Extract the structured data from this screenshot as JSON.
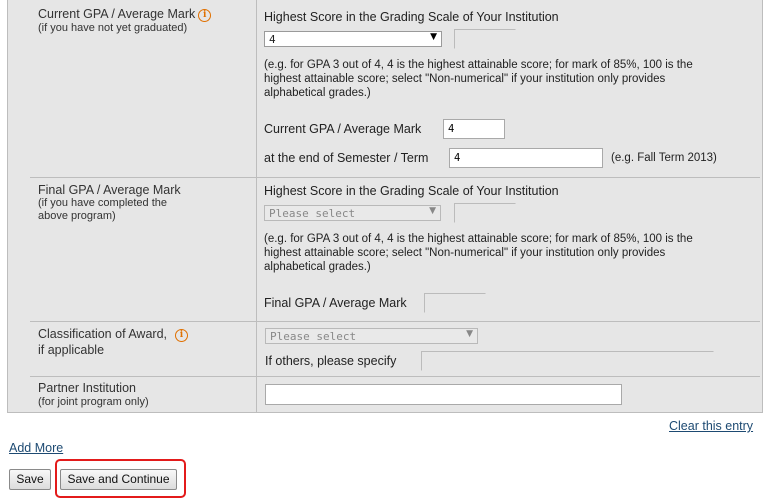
{
  "current_gpa": {
    "label": "Current GPA / Average Mark",
    "sublabel": "(if you have not yet graduated)",
    "heading": "Highest Score in the Grading Scale of Your Institution",
    "scale_select": "4",
    "note": "(e.g. for GPA 3 out of 4, 4 is the highest attainable score; for mark of 85%, 100 is the highest attainable score; select \"Non-numerical\" if your institution only provides alphabetical grades.)",
    "mark_label": "Current GPA / Average Mark",
    "mark_value": "4",
    "term_label": "at the end of Semester / Term",
    "term_value": "4",
    "term_hint": "(e.g. Fall Term 2013)"
  },
  "final_gpa": {
    "label": "Final GPA / Average Mark",
    "sublabel_line1": "(if you have completed the",
    "sublabel_line2": "above program)",
    "heading": "Highest Score in the Grading Scale of Your Institution",
    "scale_select": "Please select",
    "note": "(e.g. for GPA 3 out of 4, 4 is the highest attainable score; for mark of 85%, 100 is the highest attainable score; select \"Non-numerical\" if your institution only provides alphabetical grades.)",
    "mark_label": "Final GPA / Average Mark",
    "mark_value": ""
  },
  "classification": {
    "label_line1": "Classification of Award,",
    "label_line2": "if applicable",
    "select": "Please select",
    "others_label": "If others, please specify",
    "others_value": ""
  },
  "partner": {
    "label": "Partner Institution",
    "sublabel": "(for joint program only)",
    "value": ""
  },
  "links": {
    "clear_entry": "Clear this entry",
    "add_more": "Add More"
  },
  "buttons": {
    "save": "Save",
    "save_continue": "Save and Continue"
  },
  "colors": {
    "highlight": "#e31b1b",
    "info_icon": "#e07000",
    "link": "#1d4a72",
    "panel": "#e6e6e6"
  }
}
